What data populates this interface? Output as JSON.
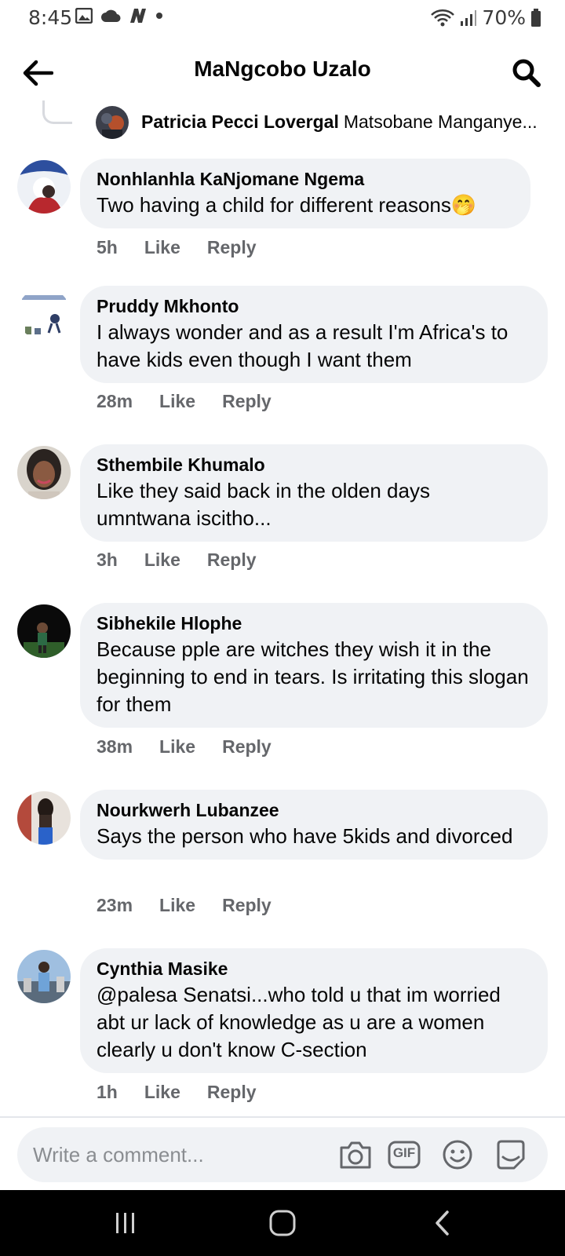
{
  "status_bar": {
    "time": "8:45",
    "battery": "70%"
  },
  "header": {
    "title": "MaNgcobo Uzalo"
  },
  "reply_preview": {
    "name": "Patricia Pecci Lovergal",
    "snippet": "Matsobane Manganye..."
  },
  "comments": [
    {
      "author": "Nonhlanhla KaNjomane Ngema",
      "text": "Two having a child for different reasons🤭",
      "time": "5h",
      "like": "Like",
      "reply": "Reply"
    },
    {
      "author": "Pruddy Mkhonto",
      "text": "I always wonder and as a result I'm Africa's to have kids even though I want them",
      "time": "28m",
      "like": "Like",
      "reply": "Reply"
    },
    {
      "author": "Sthembile Khumalo",
      "text": "Like they said back in the olden days umntwana iscitho...",
      "time": "3h",
      "like": "Like",
      "reply": "Reply"
    },
    {
      "author": "Sibhekile Hlophe",
      "text": "Because pple are witches they wish it in the beginning to end in tears. Is irritating this slogan for them",
      "time": "38m",
      "like": "Like",
      "reply": "Reply"
    },
    {
      "author": "Nourkwerh Lubanzee",
      "text": "Says the person who have 5kids and divorced",
      "time": "23m",
      "like": "Like",
      "reply": "Reply"
    },
    {
      "author": "Cynthia Masike",
      "text": "@palesa Senatsi...who told u that im worried abt ur lack of knowledge as u are a women clearly u don't know C-section",
      "time": "1h",
      "like": "Like",
      "reply": "Reply"
    }
  ],
  "composer": {
    "placeholder": "Write a comment...",
    "gif_label": "GIF"
  },
  "colors": {
    "bubble": "#f0f2f5",
    "meta_text": "#65676b",
    "text": "#050505"
  },
  "icons": [
    "back-arrow-icon",
    "search-icon",
    "camera-icon",
    "gif-icon",
    "emoji-icon",
    "sticker-icon",
    "recents-icon",
    "home-icon",
    "back-icon"
  ]
}
